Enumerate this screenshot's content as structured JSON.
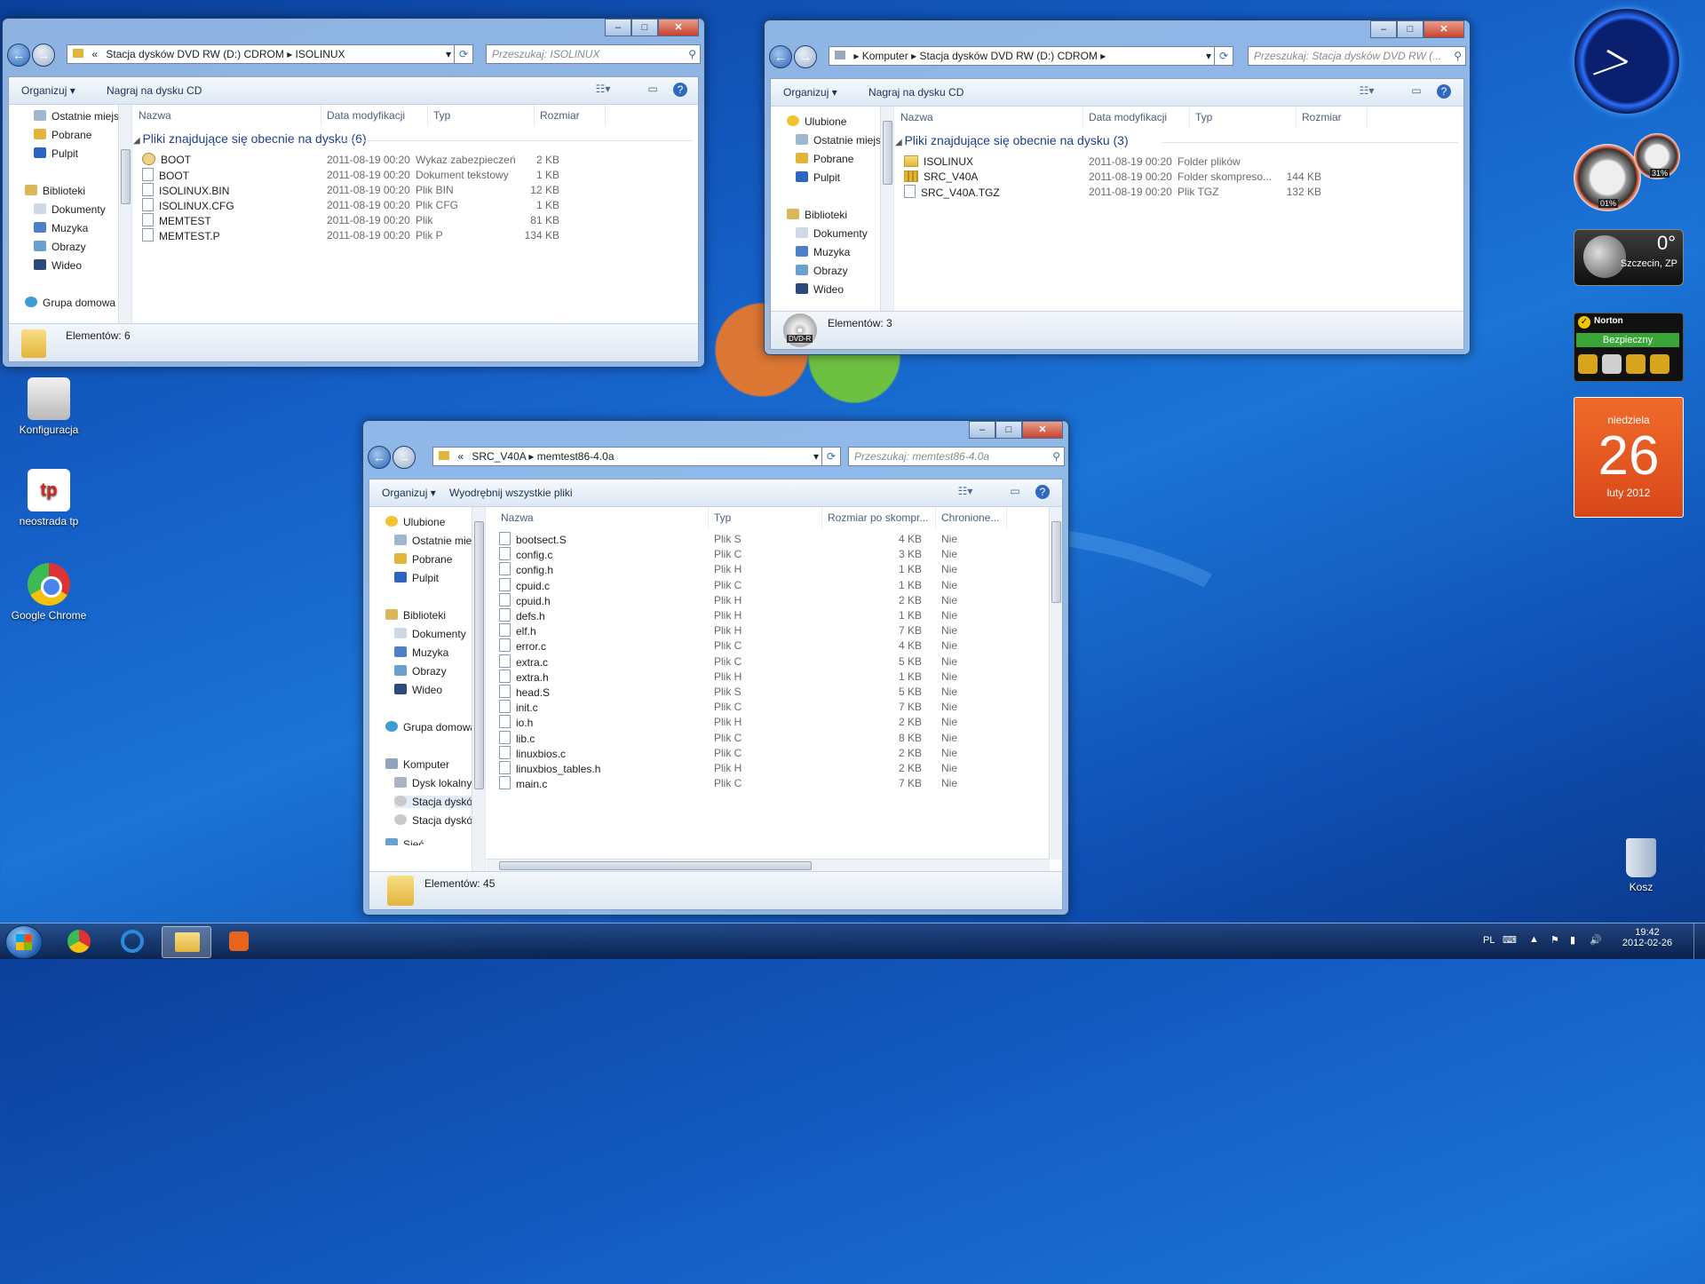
{
  "desktop": {
    "icons": [
      {
        "label": "Konfiguracja"
      },
      {
        "label": "neostrada tp"
      },
      {
        "label": "Google Chrome"
      },
      {
        "label": "Kosz"
      }
    ]
  },
  "win1": {
    "address": [
      "«",
      "Stacja dysków DVD RW (D:) CDROM",
      "ISOLINUX"
    ],
    "search_placeholder": "Przeszukaj: ISOLINUX",
    "toolbar": {
      "organize": "Organizuj",
      "burn": "Nagraj na dysku CD"
    },
    "nav": [
      "Ostatnie miejsca",
      "Pobrane",
      "Pulpit",
      "Biblioteki",
      "Dokumenty",
      "Muzyka",
      "Obrazy",
      "Wideo",
      "Grupa domowa"
    ],
    "columns": [
      "Nazwa",
      "Data modyfikacji",
      "Typ",
      "Rozmiar"
    ],
    "group": "Pliki znajdujące się obecnie na dysku (6)",
    "files": [
      {
        "icon": "sec",
        "name": "BOOT",
        "date": "2011-08-19 00:20",
        "type": "Wykaz zabezpieczeń",
        "size": "2 KB"
      },
      {
        "icon": "doc",
        "name": "BOOT",
        "date": "2011-08-19 00:20",
        "type": "Dokument tekstowy",
        "size": "1 KB"
      },
      {
        "icon": "doc",
        "name": "ISOLINUX.BIN",
        "date": "2011-08-19 00:20",
        "type": "Plik BIN",
        "size": "12 KB"
      },
      {
        "icon": "doc",
        "name": "ISOLINUX.CFG",
        "date": "2011-08-19 00:20",
        "type": "Plik CFG",
        "size": "1 KB"
      },
      {
        "icon": "doc",
        "name": "MEMTEST",
        "date": "2011-08-19 00:20",
        "type": "Plik",
        "size": "81 KB"
      },
      {
        "icon": "doc",
        "name": "MEMTEST.P",
        "date": "2011-08-19 00:20",
        "type": "Plik P",
        "size": "134 KB"
      }
    ],
    "status": "Elementów: 6"
  },
  "win2": {
    "address": [
      "Komputer",
      "Stacja dysków DVD RW (D:) CDROM"
    ],
    "search_placeholder": "Przeszukaj: Stacja dysków DVD RW (...",
    "toolbar": {
      "organize": "Organizuj",
      "burn": "Nagraj na dysku CD"
    },
    "nav": [
      "Ulubione",
      "Ostatnie miejsca",
      "Pobrane",
      "Pulpit",
      "Biblioteki",
      "Dokumenty",
      "Muzyka",
      "Obrazy",
      "Wideo"
    ],
    "columns": [
      "Nazwa",
      "Data modyfikacji",
      "Typ",
      "Rozmiar"
    ],
    "group": "Pliki znajdujące się obecnie na dysku (3)",
    "files": [
      {
        "icon": "folder",
        "name": "ISOLINUX",
        "date": "2011-08-19 00:20",
        "type": "Folder plików",
        "size": ""
      },
      {
        "icon": "zip",
        "name": "SRC_V40A",
        "date": "2011-08-19 00:20",
        "type": "Folder skompreso...",
        "size": "144 KB"
      },
      {
        "icon": "doc",
        "name": "SRC_V40A.TGZ",
        "date": "2011-08-19 00:20",
        "type": "Plik TGZ",
        "size": "132 KB"
      }
    ],
    "drive_label": "DVD-R",
    "status": "Elementów: 3"
  },
  "win3": {
    "address": [
      "«",
      "SRC_V40A",
      "memtest86-4.0a"
    ],
    "search_placeholder": "Przeszukaj: memtest86-4.0a",
    "toolbar": {
      "organize": "Organizuj",
      "extract": "Wyodrębnij wszystkie pliki"
    },
    "nav": [
      "Ulubione",
      "Ostatnie miejsca",
      "Pobrane",
      "Pulpit",
      "Biblioteki",
      "Dokumenty",
      "Muzyka",
      "Obrazy",
      "Wideo",
      "Grupa domowa",
      "Komputer",
      "Dysk lokalny (C:)",
      "Stacja dysków DV",
      "Stacja dysków DV",
      "Sieć"
    ],
    "columns": [
      "Nazwa",
      "Typ",
      "Rozmiar po skompr...",
      "Chronione..."
    ],
    "files": [
      {
        "name": "bootsect.S",
        "type": "Plik S",
        "size": "4 KB",
        "prot": "Nie"
      },
      {
        "name": "config.c",
        "type": "Plik C",
        "size": "3 KB",
        "prot": "Nie"
      },
      {
        "name": "config.h",
        "type": "Plik H",
        "size": "1 KB",
        "prot": "Nie"
      },
      {
        "name": "cpuid.c",
        "type": "Plik C",
        "size": "1 KB",
        "prot": "Nie"
      },
      {
        "name": "cpuid.h",
        "type": "Plik H",
        "size": "2 KB",
        "prot": "Nie"
      },
      {
        "name": "defs.h",
        "type": "Plik H",
        "size": "1 KB",
        "prot": "Nie"
      },
      {
        "name": "elf.h",
        "type": "Plik H",
        "size": "7 KB",
        "prot": "Nie"
      },
      {
        "name": "error.c",
        "type": "Plik C",
        "size": "4 KB",
        "prot": "Nie"
      },
      {
        "name": "extra.c",
        "type": "Plik C",
        "size": "5 KB",
        "prot": "Nie"
      },
      {
        "name": "extra.h",
        "type": "Plik H",
        "size": "1 KB",
        "prot": "Nie"
      },
      {
        "name": "head.S",
        "type": "Plik S",
        "size": "5 KB",
        "prot": "Nie"
      },
      {
        "name": "init.c",
        "type": "Plik C",
        "size": "7 KB",
        "prot": "Nie"
      },
      {
        "name": "io.h",
        "type": "Plik H",
        "size": "2 KB",
        "prot": "Nie"
      },
      {
        "name": "lib.c",
        "type": "Plik C",
        "size": "8 KB",
        "prot": "Nie"
      },
      {
        "name": "linuxbios.c",
        "type": "Plik C",
        "size": "2 KB",
        "prot": "Nie"
      },
      {
        "name": "linuxbios_tables.h",
        "type": "Plik H",
        "size": "2 KB",
        "prot": "Nie"
      },
      {
        "name": "main.c",
        "type": "Plik C",
        "size": "7 KB",
        "prot": "Nie"
      }
    ],
    "status": "Elementów: 45"
  },
  "gadgets": {
    "weather": {
      "temp": "0°",
      "city": "Szczecin, ZP"
    },
    "norton": {
      "brand": "Norton",
      "status": "Bezpieczny"
    },
    "calendar": {
      "weekday": "niedziela",
      "day": "26",
      "month": "luty 2012"
    },
    "meter": {
      "cpu": "01%",
      "ram": "31%"
    }
  },
  "taskbar": {
    "lang": "PL",
    "time": "19:42",
    "date": "2012-02-26"
  },
  "colors": {
    "group_blue": "#1e3e8e",
    "calendar_orange": "#e8551c",
    "norton_green": "#3aa63a"
  }
}
